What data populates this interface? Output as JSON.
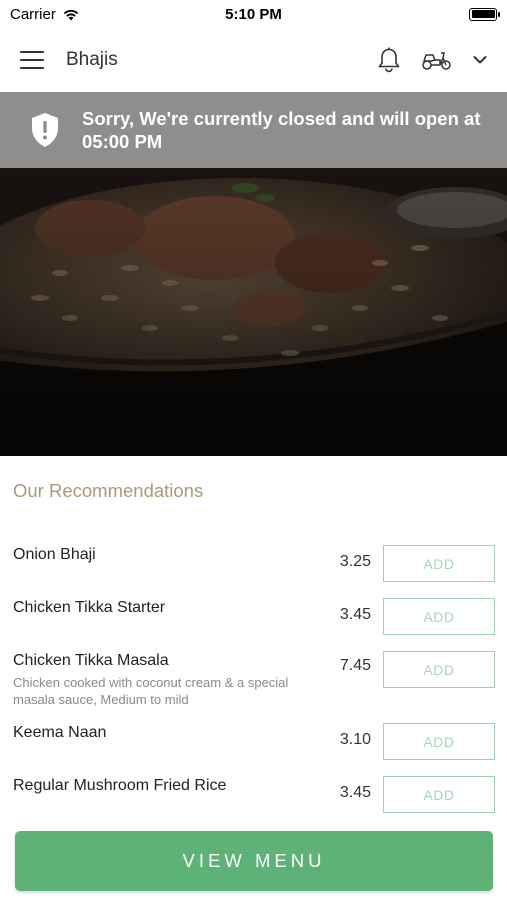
{
  "status_bar": {
    "carrier": "Carrier",
    "time": "5:10 PM",
    "icons": [
      "wifi-icon",
      "battery-icon"
    ]
  },
  "header": {
    "title": "Bhajis",
    "icons": [
      "menu-icon",
      "bell-icon",
      "scooter-icon",
      "chevron-down-icon"
    ]
  },
  "closed_banner": {
    "icon": "shield-alert-icon",
    "message": "Sorry, We're currently closed and will open at 05:00 PM",
    "background": "#8e8e8e"
  },
  "recommendations": {
    "title": "Our Recommendations",
    "items": [
      {
        "name": "Onion Bhaji",
        "description": "",
        "price": "3.25",
        "button": "ADD"
      },
      {
        "name": "Chicken Tikka Starter",
        "description": "",
        "price": "3.45",
        "button": "ADD"
      },
      {
        "name": "Chicken Tikka Masala",
        "description": "Chicken cooked with coconut cream & a special masala sauce, Medium to mild",
        "price": "7.45",
        "button": "ADD"
      },
      {
        "name": "Keema Naan",
        "description": "",
        "price": "3.10",
        "button": "ADD"
      },
      {
        "name": "Regular Mushroom Fried Rice",
        "description": "",
        "price": "3.45",
        "button": "ADD"
      }
    ]
  },
  "footer": {
    "view_menu_label": "VIEW MENU",
    "button_color": "#5fb277"
  },
  "colors": {
    "accent_title": "#a89a74",
    "add_border": "#9ed1ae",
    "add_text": "#a7d6b5"
  }
}
